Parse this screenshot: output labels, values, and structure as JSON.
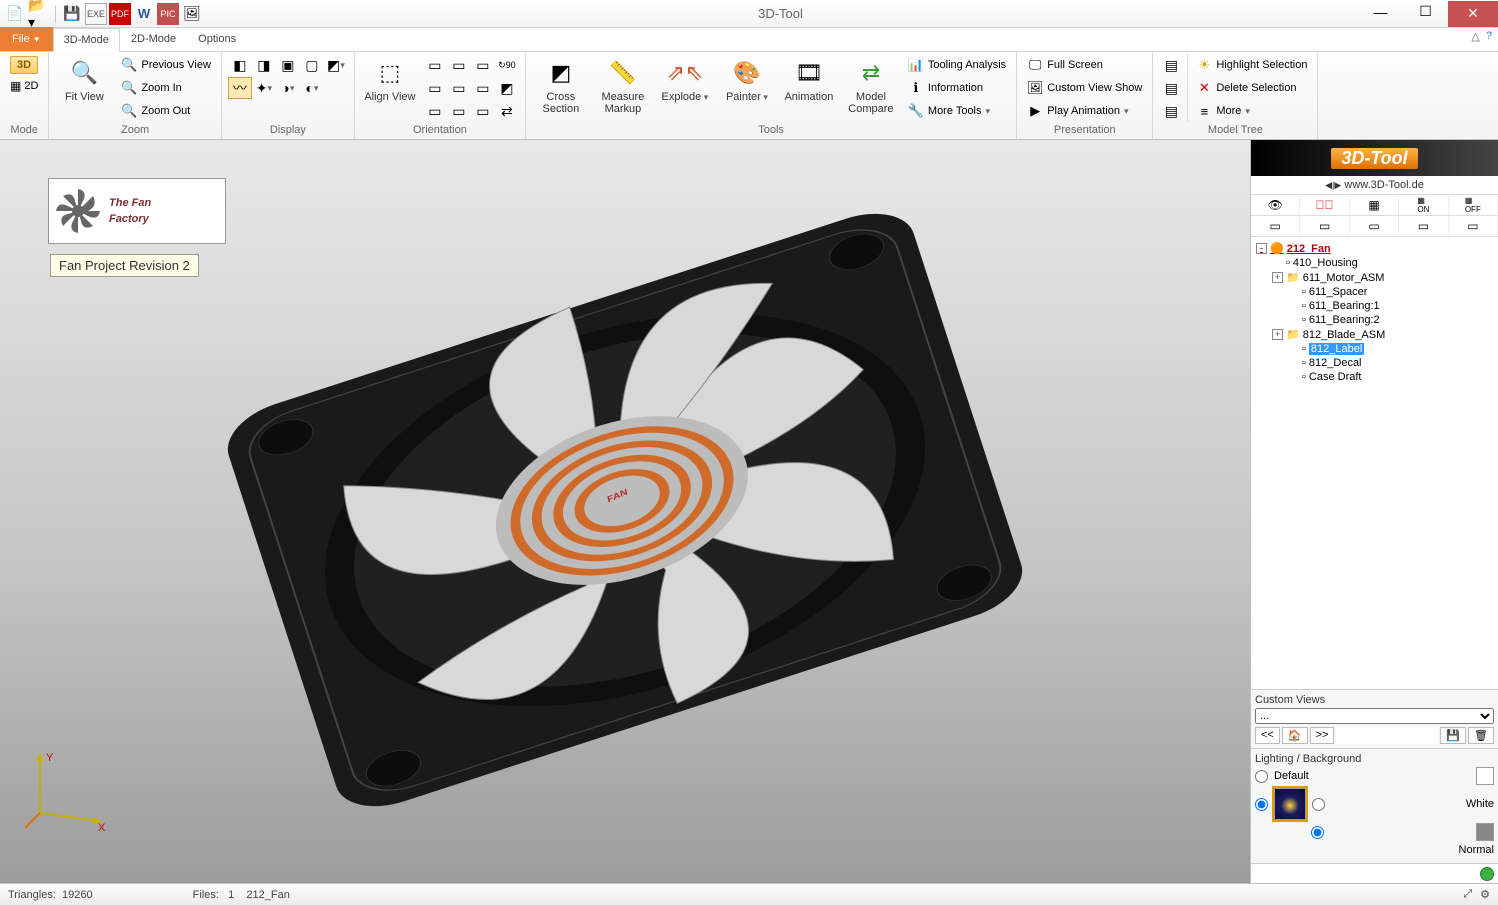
{
  "app": {
    "title": "3D-Tool"
  },
  "qat": [
    "new",
    "open",
    "save",
    "exe",
    "pdf",
    "word",
    "pic",
    "html"
  ],
  "tabs": {
    "file": "File",
    "m3d": "3D-Mode",
    "m2d": "2D-Mode",
    "options": "Options"
  },
  "ribbon": {
    "mode": {
      "label": "Mode",
      "b3d": "3D",
      "b2d": "2D"
    },
    "zoom": {
      "label": "Zoom",
      "fit": "Fit View",
      "zin": "Zoom In",
      "zout": "Zoom Out",
      "prev": "Previous View"
    },
    "display": {
      "label": "Display"
    },
    "orientation": {
      "label": "Orientation",
      "align": "Align View"
    },
    "tools": {
      "label": "Tools",
      "cross": "Cross Section",
      "measure": "Measure Markup",
      "explode": "Explode",
      "painter": "Painter",
      "anim": "Animation",
      "compare": "Model Compare",
      "tooling": "Tooling Analysis",
      "info": "Information",
      "more": "More Tools"
    },
    "presentation": {
      "label": "Presentation",
      "full": "Full Screen",
      "custom": "Custom View Show",
      "play": "Play Animation"
    },
    "modeltree": {
      "label": "Model Tree",
      "highlight": "Highlight Selection",
      "delete": "Delete Selection",
      "more": "More"
    }
  },
  "viewport": {
    "logo1": "The Fan",
    "logo2": "Factory",
    "caption": "Fan Project Revision 2",
    "fan_label": "FAN",
    "axis_x": "X",
    "axis_y": "Y"
  },
  "rightpanel": {
    "brand": "3D-Tool",
    "url": "www.3D-Tool.de",
    "tree": [
      {
        "depth": 0,
        "exp": "-",
        "name": "212_Fan",
        "root": true
      },
      {
        "depth": 1,
        "exp": "",
        "name": "410_Housing"
      },
      {
        "depth": 1,
        "exp": "+",
        "name": "611_Motor_ASM"
      },
      {
        "depth": 2,
        "exp": "",
        "name": "611_Spacer"
      },
      {
        "depth": 2,
        "exp": "",
        "name": "611_Bearing:1"
      },
      {
        "depth": 2,
        "exp": "",
        "name": "611_Bearing:2"
      },
      {
        "depth": 1,
        "exp": "+",
        "name": "812_Blade_ASM"
      },
      {
        "depth": 2,
        "exp": "",
        "name": "812_Label",
        "sel": true
      },
      {
        "depth": 2,
        "exp": "",
        "name": "812_Decal"
      },
      {
        "depth": 2,
        "exp": "",
        "name": "Case Draft"
      }
    ],
    "cv": {
      "label": "Custom Views",
      "sel": "...",
      "nav_prev": "<<",
      "nav_next": ">>"
    },
    "lb": {
      "label": "Lighting / Background",
      "default": "Default",
      "white": "White",
      "normal": "Normal"
    }
  },
  "status": {
    "triangles_lbl": "Triangles:",
    "triangles_val": "19260",
    "files_lbl": "Files:",
    "files_val": "1",
    "filename": "212_Fan"
  }
}
